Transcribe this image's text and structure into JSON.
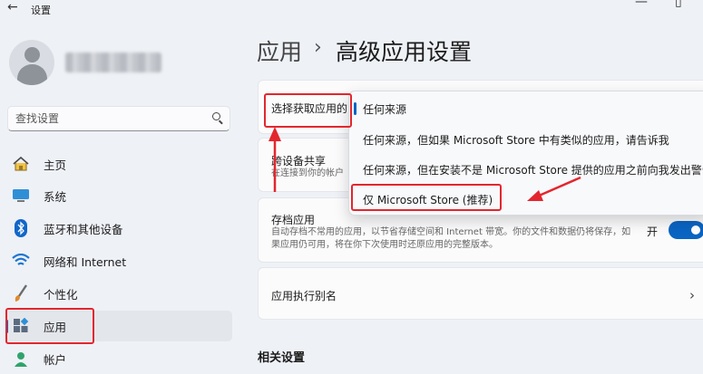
{
  "window": {
    "title": "设置",
    "back_icon": "arrow-left-icon",
    "minimize_glyph": "—",
    "maximize_glyph": "▯"
  },
  "sidebar": {
    "search_placeholder": "查找设置",
    "items": [
      {
        "label": "主页",
        "icon": "home-icon"
      },
      {
        "label": "系统",
        "icon": "monitor-icon"
      },
      {
        "label": "蓝牙和其他设备",
        "icon": "bluetooth-icon"
      },
      {
        "label": "网络和 Internet",
        "icon": "wifi-icon"
      },
      {
        "label": "个性化",
        "icon": "brush-icon"
      },
      {
        "label": "应用",
        "icon": "apps-icon",
        "active": true
      },
      {
        "label": "帐户",
        "icon": "account-icon"
      }
    ]
  },
  "header": {
    "parent": "应用",
    "separator": "›",
    "title": "高级应用设置"
  },
  "settings": {
    "choose_source": {
      "title": "选择获取应用的",
      "value": "任何来源"
    },
    "share_across": {
      "title": "跨设备共享",
      "desc": "在连接到你的帐户"
    },
    "archive": {
      "title": "存档应用",
      "desc": "自动存档不常用的应用，以节省存储空间和 Internet 带宽。你的文件和数据仍将保存，如果应用仍可用，将在你下次使用时还原应用的完整版本。",
      "toggle_label": "开"
    },
    "execution_alias": {
      "title": "应用执行别名"
    }
  },
  "dropdown": {
    "options": [
      "任何来源",
      "任何来源，但如果 Microsoft Store 中有类似的应用，请告诉我",
      "任何来源，但在安装不是 Microsoft Store 提供的应用之前向我发出警告",
      "仅 Microsoft Store (推荐)"
    ],
    "selected_index": 0
  },
  "related": {
    "title": "相关设置"
  },
  "colors": {
    "accent": "#0a64c2",
    "annotation": "#e3262e"
  }
}
